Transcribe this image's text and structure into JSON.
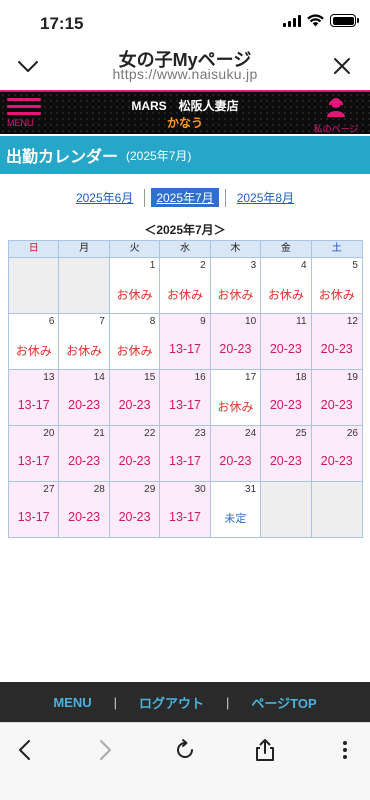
{
  "status": {
    "time": "17:15"
  },
  "browser": {
    "title": "女の子Myページ",
    "url": "https://www.naisuku.jp"
  },
  "site": {
    "menu_label": "MENU",
    "shop": "MARS　松阪人妻店",
    "girl": "かなう",
    "mypage_label": "私のページ",
    "accent": "#e3177a"
  },
  "section": {
    "title": "出勤カレンダー",
    "subtitle": "(2025年7月)",
    "color": "#26a6c9"
  },
  "month_nav": {
    "prev": "2025年6月",
    "current": "2025年7月",
    "next": "2025年8月"
  },
  "calendar": {
    "title": "＜2025年7月＞",
    "weekdays": [
      "日",
      "月",
      "火",
      "水",
      "木",
      "金",
      "土"
    ],
    "weeks": [
      [
        {
          "day": "",
          "text": "",
          "type": "empty"
        },
        {
          "day": "",
          "text": "",
          "type": "empty"
        },
        {
          "day": "1",
          "text": "お休み",
          "type": "holiday"
        },
        {
          "day": "2",
          "text": "お休み",
          "type": "holiday"
        },
        {
          "day": "3",
          "text": "お休み",
          "type": "holiday"
        },
        {
          "day": "4",
          "text": "お休み",
          "type": "holiday"
        },
        {
          "day": "5",
          "text": "お休み",
          "type": "holiday"
        }
      ],
      [
        {
          "day": "6",
          "text": "お休み",
          "type": "holiday"
        },
        {
          "day": "7",
          "text": "お休み",
          "type": "holiday"
        },
        {
          "day": "8",
          "text": "お休み",
          "type": "holiday"
        },
        {
          "day": "9",
          "text": "13-17",
          "type": "work"
        },
        {
          "day": "10",
          "text": "20-23",
          "type": "work"
        },
        {
          "day": "11",
          "text": "20-23",
          "type": "work"
        },
        {
          "day": "12",
          "text": "20-23",
          "type": "work"
        }
      ],
      [
        {
          "day": "13",
          "text": "13-17",
          "type": "work"
        },
        {
          "day": "14",
          "text": "20-23",
          "type": "work"
        },
        {
          "day": "15",
          "text": "20-23",
          "type": "work"
        },
        {
          "day": "16",
          "text": "13-17",
          "type": "work"
        },
        {
          "day": "17",
          "text": "お休み",
          "type": "holiday"
        },
        {
          "day": "18",
          "text": "20-23",
          "type": "work"
        },
        {
          "day": "19",
          "text": "20-23",
          "type": "work"
        }
      ],
      [
        {
          "day": "20",
          "text": "13-17",
          "type": "work"
        },
        {
          "day": "21",
          "text": "20-23",
          "type": "work"
        },
        {
          "day": "22",
          "text": "20-23",
          "type": "work"
        },
        {
          "day": "23",
          "text": "13-17",
          "type": "work"
        },
        {
          "day": "24",
          "text": "20-23",
          "type": "work"
        },
        {
          "day": "25",
          "text": "20-23",
          "type": "work"
        },
        {
          "day": "26",
          "text": "20-23",
          "type": "work"
        }
      ],
      [
        {
          "day": "27",
          "text": "13-17",
          "type": "work"
        },
        {
          "day": "28",
          "text": "20-23",
          "type": "work"
        },
        {
          "day": "29",
          "text": "20-23",
          "type": "work"
        },
        {
          "day": "30",
          "text": "13-17",
          "type": "work"
        },
        {
          "day": "31",
          "text": "未定",
          "type": "undecided"
        },
        {
          "day": "",
          "text": "",
          "type": "empty"
        },
        {
          "day": "",
          "text": "",
          "type": "empty"
        }
      ]
    ]
  },
  "footer": {
    "menu": "MENU",
    "sep": "|",
    "logout": "ログアウト",
    "pagetop": "ページTOP"
  }
}
